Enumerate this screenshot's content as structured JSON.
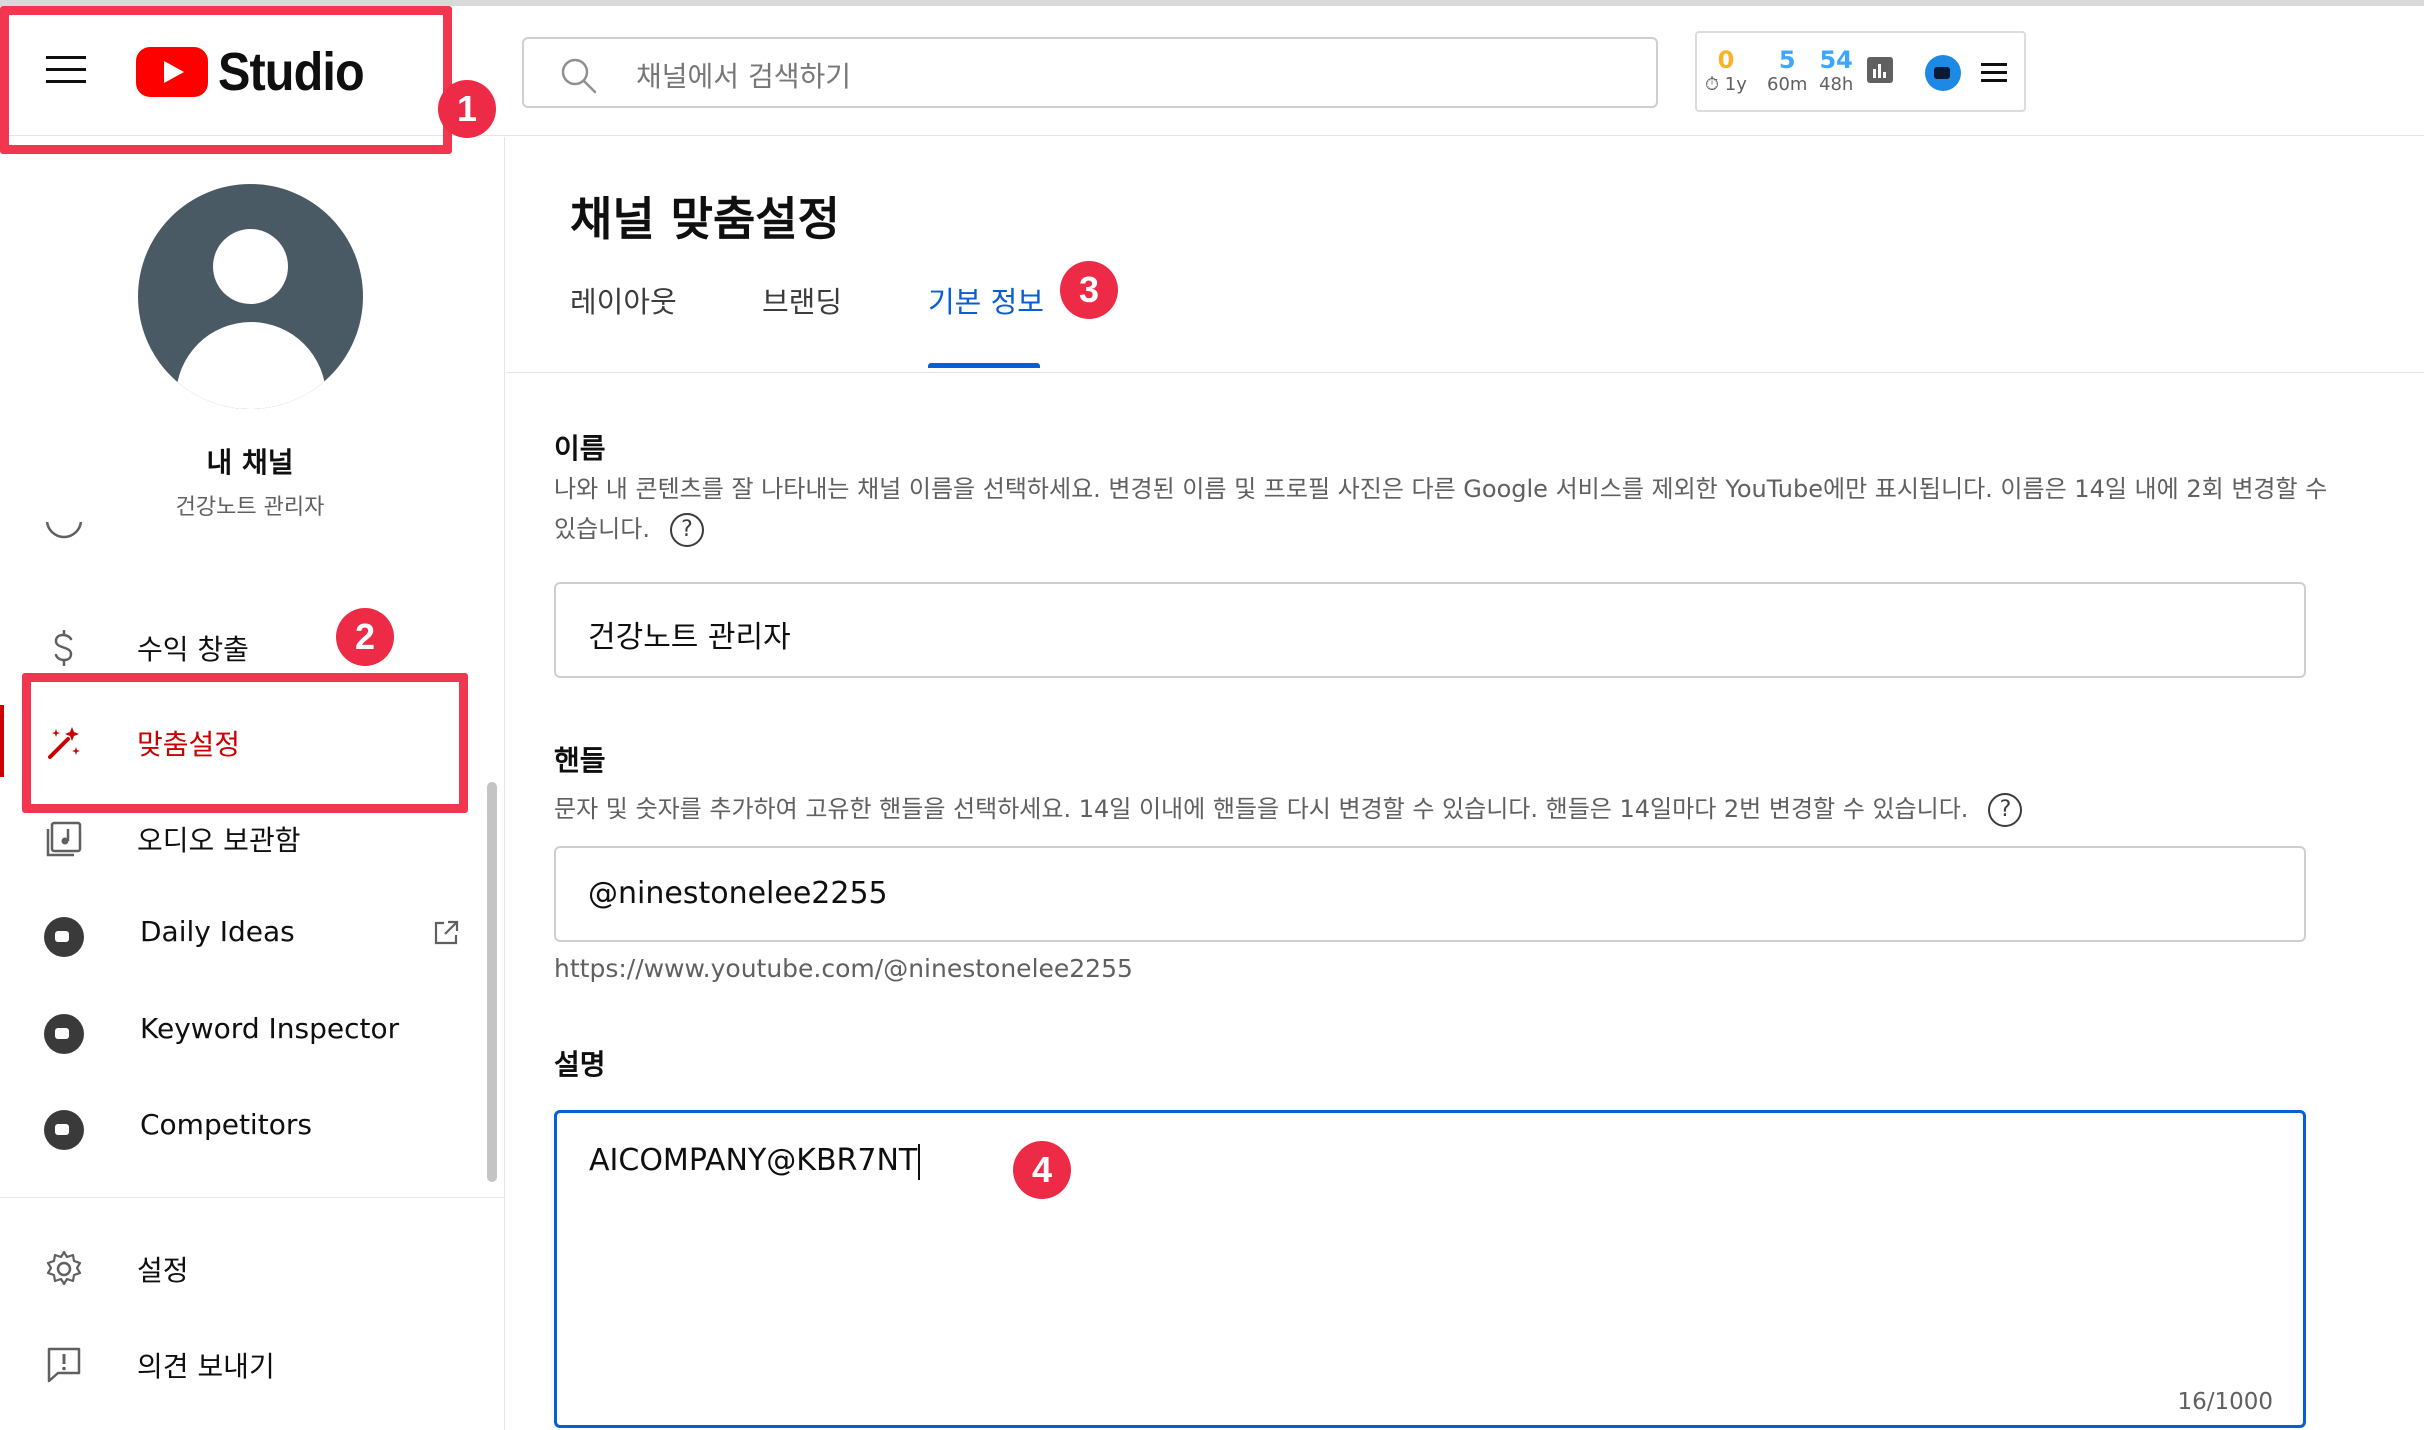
{
  "header": {
    "logo_text": "Studio",
    "search_placeholder": "채널에서 검색하기",
    "stats": [
      {
        "value": "0",
        "label": "⏱ 1y",
        "color": "#f9b22a"
      },
      {
        "value": "5",
        "label": "60m",
        "color": "#3ea6ff"
      },
      {
        "value": "54",
        "label": "48h",
        "color": "#3ea6ff"
      }
    ]
  },
  "sidebar": {
    "channel_name": "내 채널",
    "channel_subtitle": "건강노트 관리자",
    "items": [
      {
        "label": "수익 창출"
      },
      {
        "label": "맞춤설정"
      },
      {
        "label": "오디오 보관함"
      },
      {
        "label": "Daily Ideas"
      },
      {
        "label": "Keyword Inspector"
      },
      {
        "label": "Competitors"
      },
      {
        "label": "설정"
      },
      {
        "label": "의견 보내기"
      }
    ]
  },
  "main": {
    "page_title": "채널 맞춤설정",
    "tabs": [
      {
        "label": "레이아웃"
      },
      {
        "label": "브랜딩"
      },
      {
        "label": "기본 정보"
      }
    ],
    "name_section": {
      "title": "이름",
      "description": "나와 내 콘텐츠를 잘 나타내는 채널 이름을 선택하세요. 변경된 이름 및 프로필 사진은 다른 Google 서비스를 제외한 YouTube에만 표시됩니다. 이름은 14일 내에 2회 변경할 수 있습니다.",
      "value": "건강노트 관리자"
    },
    "handle_section": {
      "title": "핸들",
      "description": "문자 및 숫자를 추가하여 고유한 핸들을 선택하세요. 14일 이내에 핸들을 다시 변경할 수 있습니다. 핸들은 14일마다 2번 변경할 수 있습니다.",
      "value": "@ninestonelee2255",
      "url": "https://www.youtube.com/@ninestonelee2255"
    },
    "description_section": {
      "title": "설명",
      "value": "AICOMPANY@KBR7NT",
      "counter": "16/1000"
    },
    "help_glyph": "?"
  },
  "annotations": [
    "1",
    "2",
    "3",
    "4"
  ],
  "colors": {
    "accent_blue": "#065fd4",
    "active_red": "#cc0000",
    "annotation_red": "#f2364f"
  }
}
